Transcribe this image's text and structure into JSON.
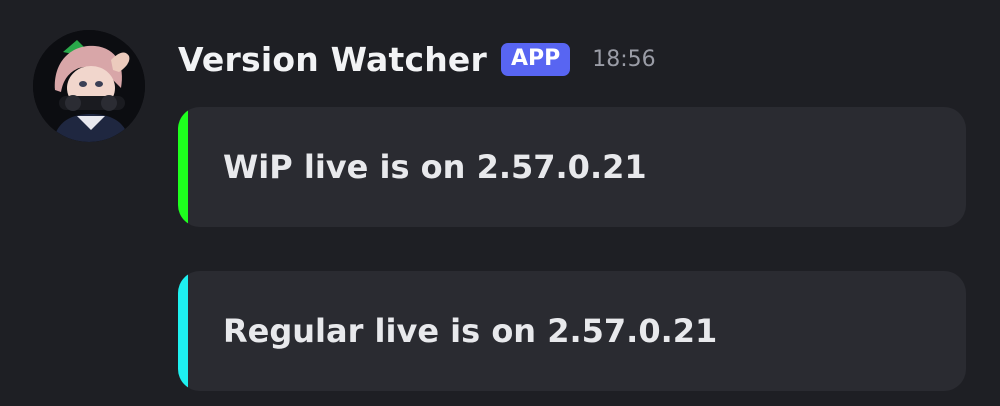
{
  "message": {
    "author": {
      "name": "Version Watcher",
      "badge": "APP",
      "avatar_icon": "anime-character-avatar"
    },
    "timestamp": "18:56",
    "embeds": [
      {
        "text": "WiP live is on 2.57.0.21",
        "accent_color": "#1eff1e"
      },
      {
        "text": "Regular live is on 2.57.0.21",
        "accent_color": "#1ef0f0"
      }
    ]
  },
  "colors": {
    "background": "#1e1f24",
    "embed_background": "#2a2b31",
    "badge": "#5865f2",
    "timestamp": "#9a9ca6"
  }
}
